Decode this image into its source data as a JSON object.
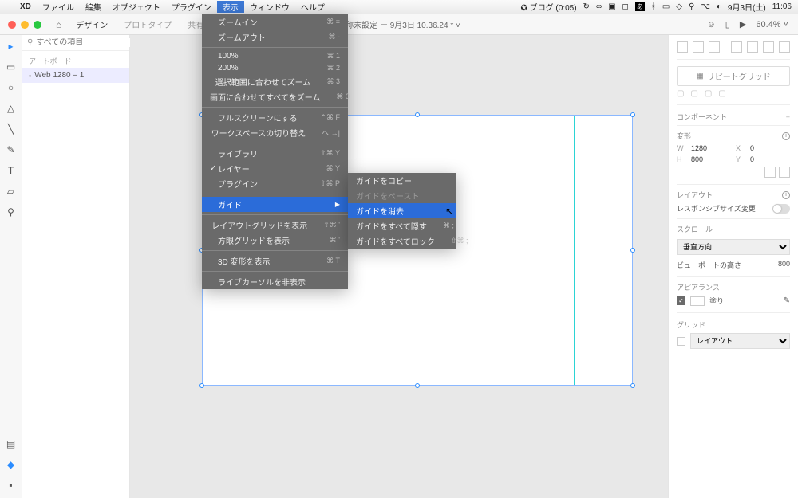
{
  "menubar": {
    "app": "XD",
    "items": [
      "ファイル",
      "編集",
      "オブジェクト",
      "プラグイン",
      "表示",
      "ウィンドウ",
      "ヘルプ"
    ],
    "active_idx": 4,
    "right": {
      "blog": "✪ ブログ (0:05)",
      "date": "9月3日(土)",
      "time": "11:06"
    }
  },
  "toolbar": {
    "modes": [
      "デザイン",
      "プロトタイプ",
      "共有"
    ],
    "doc_title": "名称未設定 ー 9月3日 10.36.24 * ˅",
    "zoom": "60.4%  ˅"
  },
  "left": {
    "search_placeholder": "すべての項目",
    "section": "アートボード",
    "layer": "Web 1280 – 1"
  },
  "dropdown": {
    "zoom_in": "ズームイン",
    "zoom_in_sc": "⌘ =",
    "zoom_out": "ズームアウト",
    "zoom_out_sc": "⌘ -",
    "p100": "100%",
    "p100_sc": "⌘ 1",
    "p200": "200%",
    "p200_sc": "⌘ 2",
    "fit_sel": "選択範囲に合わせてズーム",
    "fit_sel_sc": "⌘ 3",
    "fit_all": "画面に合わせてすべてをズーム",
    "fit_all_sc": "⌘ 0",
    "fullscreen": "フルスクリーンにする",
    "fullscreen_sc": "⌃⌘ F",
    "workspace": "ワークスペースの切り替え",
    "workspace_sc": "ヘ →|",
    "library": "ライブラリ",
    "library_sc": "⇧⌘ Y",
    "layers": "レイヤー",
    "layers_sc": "⌘ Y",
    "plugins": "プラグイン",
    "plugins_sc": "⇧⌘ P",
    "guides": "ガイド",
    "layout_grid": "レイアウトグリッドを表示",
    "layout_grid_sc": "⇧⌘ '",
    "square_grid": "方眼グリッドを表示",
    "square_grid_sc": "⌘ '",
    "transform3d": "3D 変形を表示",
    "transform3d_sc": "⌘ T",
    "live_cursor": "ライブカーソルを非表示"
  },
  "submenu": {
    "copy": "ガイドをコピー",
    "paste": "ガイドをペースト",
    "clear": "ガイドを消去",
    "hide_all": "ガイドをすべて隠す",
    "hide_all_sc": "⌘ ;",
    "lock_all": "ガイドをすべてロック",
    "lock_all_sc": "⇧⌘ ;"
  },
  "right": {
    "repeat_grid": "リピートグリッド",
    "component_hd": "コンポーネント",
    "transform_hd": "変形",
    "w_lbl": "W",
    "w_val": "1280",
    "x_lbl": "X",
    "x_val": "0",
    "h_lbl": "H",
    "h_val": "800",
    "y_lbl": "Y",
    "y_val": "0",
    "layout_hd": "レイアウト",
    "responsive": "レスポンシブサイズ変更",
    "scroll_hd": "スクロール",
    "scroll_val": "垂直方向",
    "vp_lbl": "ビューポートの高さ",
    "vp_val": "800",
    "appearance_hd": "アピアランス",
    "fill": "塗り",
    "grid_hd": "グリッド",
    "grid_val": "レイアウト"
  }
}
